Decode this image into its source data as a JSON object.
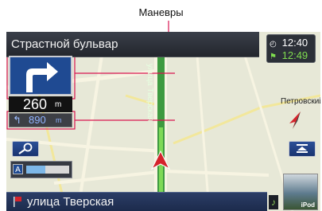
{
  "caption": "Маневры",
  "header": {
    "street": "Страстной бульвар"
  },
  "clock": {
    "time1": "12:40",
    "time2": "12:49"
  },
  "guidance": {
    "distance_value": "260",
    "distance_unit": "m",
    "next_distance_value": "890",
    "next_distance_unit": "m"
  },
  "map": {
    "road_label": "улица Тверская",
    "street_label_right": "Петровский п"
  },
  "scale": {
    "min": "10",
    "max": "50",
    "level": 0.45
  },
  "bottom": {
    "street": "улица Тверская",
    "ipod_label": "iPod"
  },
  "icons": {
    "turn": "right-turn-arrow",
    "next_turn": "left-turn-arrow",
    "search": "search-icon",
    "reroute": "route-icon",
    "compass": "compass-arrow",
    "vehicle": "vehicle-arrow"
  }
}
